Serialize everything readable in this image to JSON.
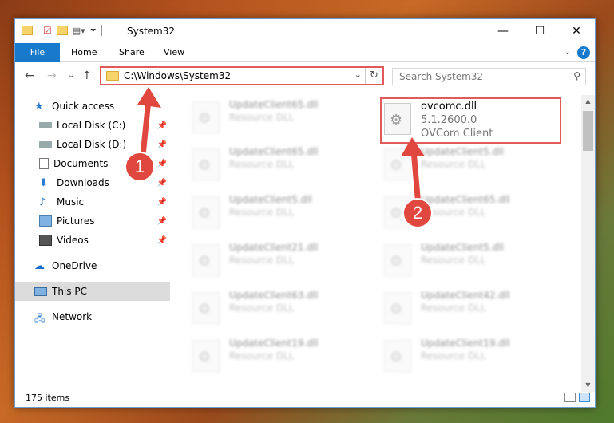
{
  "window": {
    "title": "System32"
  },
  "ribbon": {
    "tabs": [
      {
        "label": "File"
      },
      {
        "label": "Home"
      },
      {
        "label": "Share"
      },
      {
        "label": "View"
      }
    ],
    "help": "?"
  },
  "nav": {
    "address_path": "C:\\Windows\\System32",
    "search_placeholder": "Search System32"
  },
  "sidebar": {
    "items": [
      {
        "label": "Quick access"
      },
      {
        "label": "Local Disk (C:)"
      },
      {
        "label": "Local Disk (D:)"
      },
      {
        "label": "Documents"
      },
      {
        "label": "Downloads"
      },
      {
        "label": "Music"
      },
      {
        "label": "Pictures"
      },
      {
        "label": "Videos"
      },
      {
        "label": "OneDrive"
      },
      {
        "label": "This PC"
      },
      {
        "label": "Network"
      }
    ]
  },
  "files": {
    "left": [
      {
        "name": "UpdateClient65.dll",
        "type": "Resource DLL"
      },
      {
        "name": "UpdateClient65.dll",
        "type": "Resource DLL"
      },
      {
        "name": "UpdateClient5.dll",
        "type": "Resource DLL"
      },
      {
        "name": "UpdateClient21.dll",
        "type": "Resource DLL"
      },
      {
        "name": "UpdateClient63.dll",
        "type": "Resource DLL"
      },
      {
        "name": "UpdateClient19.dll",
        "type": "Resource DLL"
      }
    ],
    "right_top": {
      "name": "ovcomc.dll",
      "version": "5.1.2600.0",
      "desc": "OVCom Client"
    },
    "right": [
      {
        "name": "UpdateClient5.dll",
        "type": "Resource DLL"
      },
      {
        "name": "UpdateClient65.dll",
        "type": "Resource DLL"
      },
      {
        "name": "UpdateClient5.dll",
        "type": "Resource DLL"
      },
      {
        "name": "UpdateClient42.dll",
        "type": "Resource DLL"
      },
      {
        "name": "UpdateClient19.dll",
        "type": "Resource DLL"
      }
    ]
  },
  "status": {
    "count": "175 items"
  },
  "annotations": {
    "badge1": "1",
    "badge2": "2"
  }
}
